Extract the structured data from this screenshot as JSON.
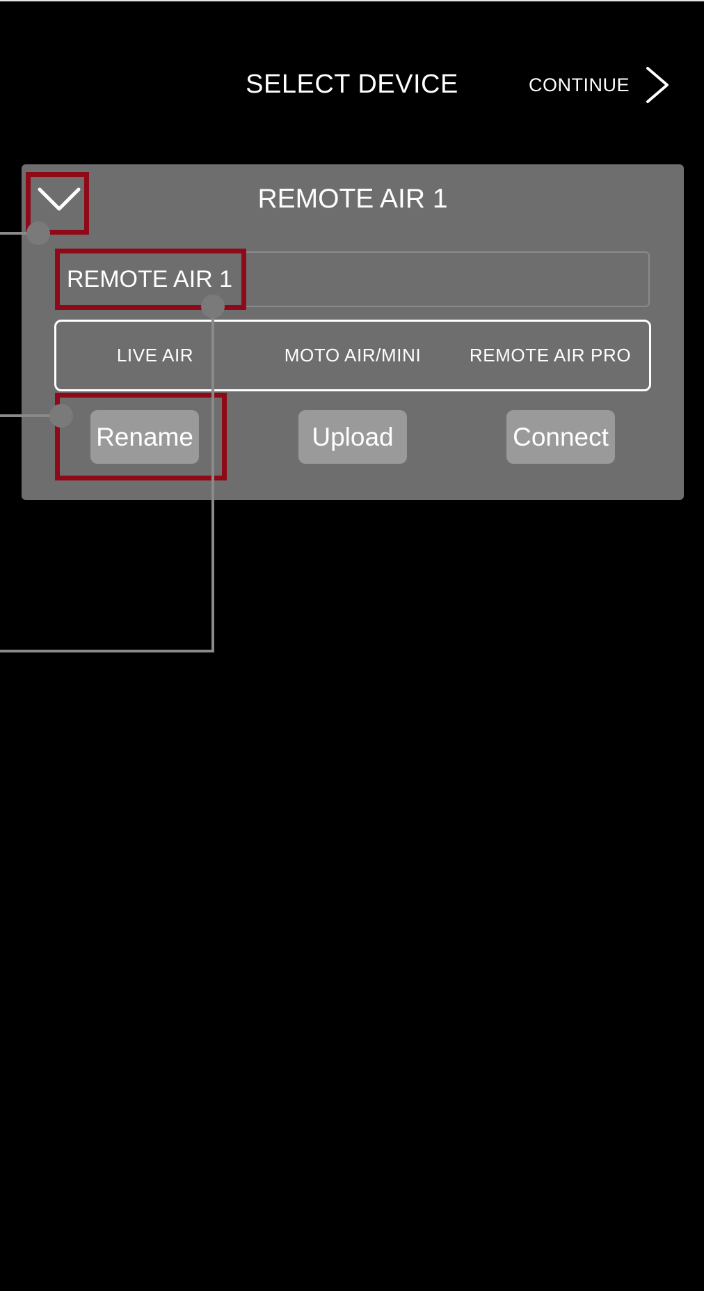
{
  "header": {
    "title": "SELECT DEVICE",
    "continue_label": "CONTINUE",
    "continue_icon": "chevron-right-icon"
  },
  "device_panel": {
    "title": "REMOTE AIR 1",
    "collapse_icon": "chevron-down-icon",
    "name_field_value": "REMOTE AIR 1",
    "device_types": [
      "LIVE AIR",
      "MOTO AIR/MINI",
      "REMOTE AIR PRO"
    ],
    "buttons": {
      "rename": "Rename",
      "upload": "Upload",
      "connect": "Connect"
    }
  },
  "colors": {
    "background": "#000000",
    "panel": "#6e6e6e",
    "button": "#9a9a9a",
    "highlight": "#8e0a18",
    "callout": "#8a8a8a",
    "text": "#ffffff"
  }
}
